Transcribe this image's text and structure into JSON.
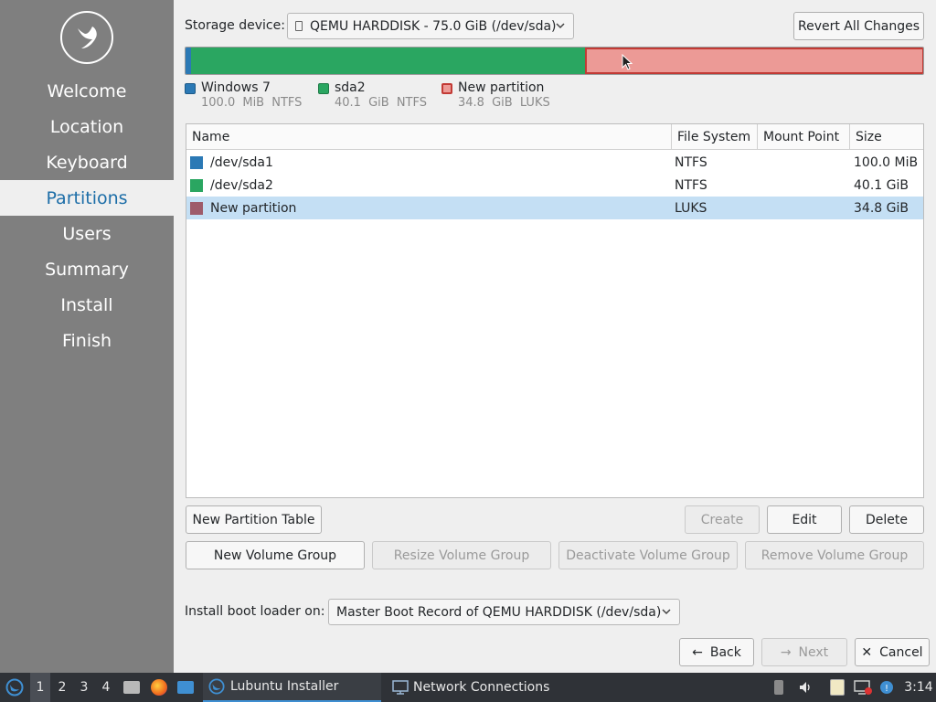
{
  "sidebar": {
    "items": [
      {
        "label": "Welcome"
      },
      {
        "label": "Location"
      },
      {
        "label": "Keyboard"
      },
      {
        "label": "Partitions",
        "active": true
      },
      {
        "label": "Users"
      },
      {
        "label": "Summary"
      },
      {
        "label": "Install"
      },
      {
        "label": "Finish"
      }
    ]
  },
  "storage": {
    "label": "Storage device:",
    "device": "QEMU HARDDISK - 75.0 GiB (/dev/sda)",
    "revert_label": "Revert All Changes"
  },
  "legend": [
    {
      "name": "Windows 7",
      "size": "100.0 MiB",
      "fs": "NTFS",
      "color": "#2b79b5"
    },
    {
      "name": "sda2",
      "size": "40.1 GiB",
      "fs": "NTFS",
      "color": "#2aa661"
    },
    {
      "name": "New partition",
      "size": "34.8 GiB",
      "fs": "LUKS",
      "color": "#ec9a96"
    }
  ],
  "table": {
    "headers": [
      "Name",
      "File System",
      "Mount Point",
      "Size"
    ],
    "rows": [
      {
        "name": "/dev/sda1",
        "fs": "NTFS",
        "mount": "",
        "size": "100.0 MiB",
        "color": "#2b79b5"
      },
      {
        "name": "/dev/sda2",
        "fs": "NTFS",
        "mount": "",
        "size": "40.1 GiB",
        "color": "#2aa661"
      },
      {
        "name": "New partition",
        "fs": "LUKS",
        "mount": "",
        "size": "34.8 GiB",
        "color": "#9e5b6a",
        "selected": true
      }
    ]
  },
  "buttons": {
    "new_partition_table": "New Partition Table",
    "create": "Create",
    "edit": "Edit",
    "delete": "Delete",
    "new_volume_group": "New Volume Group",
    "resize_volume_group": "Resize Volume Group",
    "deactivate_volume_group": "Deactivate Volume Group",
    "remove_volume_group": "Remove Volume Group"
  },
  "bootloader": {
    "label": "Install boot loader on:",
    "value": "Master Boot Record of QEMU HARDDISK (/dev/sda)"
  },
  "nav_buttons": {
    "back": "Back",
    "next": "Next",
    "cancel": "Cancel"
  },
  "taskbar": {
    "desktops": [
      "1",
      "2",
      "3",
      "4"
    ],
    "tasks": [
      {
        "label": "Lubuntu Installer",
        "icon": "lubuntu-icon"
      },
      {
        "label": "Network Connections",
        "icon": "network-icon"
      }
    ],
    "clock": "3:14"
  }
}
